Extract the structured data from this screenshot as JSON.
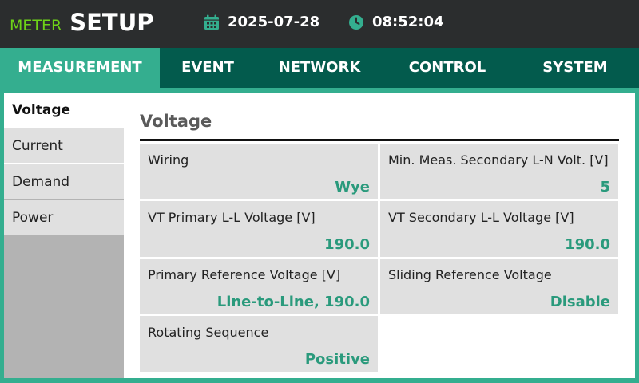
{
  "header": {
    "brand_prefix": "METER",
    "brand_title": "SETUP",
    "date": "2025-07-28",
    "time": "08:52:04",
    "date_icon": "calendar-icon",
    "time_icon": "clock-icon"
  },
  "tabs": [
    {
      "label": "MEASUREMENT",
      "active": true
    },
    {
      "label": "EVENT",
      "active": false
    },
    {
      "label": "NETWORK",
      "active": false
    },
    {
      "label": "CONTROL",
      "active": false
    },
    {
      "label": "SYSTEM",
      "active": false
    }
  ],
  "sidebar": {
    "items": [
      {
        "label": "Voltage",
        "active": true
      },
      {
        "label": "Current",
        "active": false
      },
      {
        "label": "Demand",
        "active": false
      },
      {
        "label": "Power",
        "active": false
      }
    ]
  },
  "panel": {
    "title": "Voltage",
    "settings": [
      {
        "label": "Wiring",
        "value": "Wye"
      },
      {
        "label": "Min. Meas. Secondary L-N Volt. [V]",
        "value": "5"
      },
      {
        "label": "VT Primary L-L Voltage [V]",
        "value": "190.0"
      },
      {
        "label": "VT Secondary L-L Voltage [V]",
        "value": "190.0"
      },
      {
        "label": "Primary Reference Voltage [V]",
        "value": "Line-to-Line, 190.0"
      },
      {
        "label": "Sliding Reference Voltage",
        "value": "Disable"
      },
      {
        "label": "Rotating Sequence",
        "value": "Positive"
      }
    ]
  },
  "colors": {
    "header_bg": "#2b2d2e",
    "brand_accent": "#6ed318",
    "tabbar_bg": "#035b4d",
    "tab_active_bg": "#34ae8f",
    "value_text": "#2a9a7c",
    "cell_bg": "#e0e0e0",
    "sidebar_fill": "#b3b3b3"
  }
}
